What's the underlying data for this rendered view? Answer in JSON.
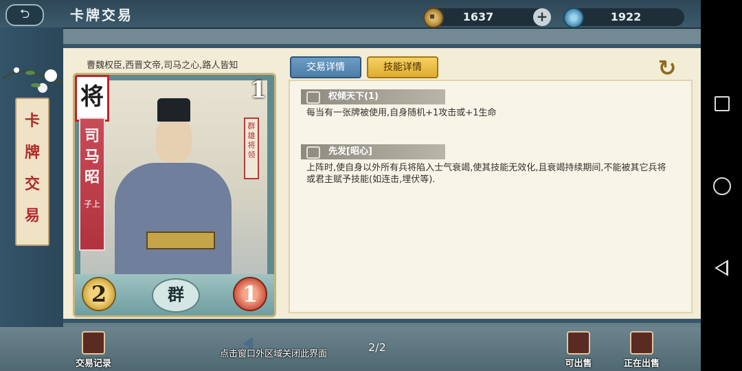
{
  "header": {
    "title": "卡牌交易",
    "back_icon": "back-arrow-icon",
    "coins": "1637",
    "coin_icon": "copper-coin-icon",
    "plus_label": "+",
    "gems": "1922",
    "gem_icon": "jade-gem-icon"
  },
  "sidebar": {
    "title_chars": [
      "卡",
      "牌",
      "交",
      "易"
    ]
  },
  "card": {
    "caption": "曹魏权臣,西晋文帝,司马之心,路人皆知",
    "rank": "将",
    "name_chars": [
      "司",
      "马",
      "昭"
    ],
    "courtesy_name": "子上",
    "cost": "1",
    "seal_text": "群雄将领",
    "attack": "2",
    "faction": "群",
    "health": "1"
  },
  "tabs": [
    {
      "label": "交易详情",
      "active": false
    },
    {
      "label": "技能详情",
      "active": true
    }
  ],
  "skills": [
    {
      "name": "权倾天下(1)",
      "desc": "每当有一张牌被使用,自身随机+1攻击或+1生命"
    },
    {
      "name": "先发[昭心]",
      "desc": "上阵时,使自身以外所有兵将陷入士气衰竭,使其技能无效化,且衰竭持续期间,不能被其它兵将或君主赋予技能(如连击,埋伏等)."
    }
  ],
  "bottom": {
    "trade_record": "交易记录",
    "close_hint": "点击窗口外区域关闭此界面",
    "page": "2/2",
    "can_sell": "可出售",
    "selling": "正在出售"
  },
  "colors": {
    "accent_blue": "#35566a",
    "tab_active": "#e0ac2d",
    "tab_inactive": "#4e7ea8",
    "name_banner": "#b0333f"
  }
}
